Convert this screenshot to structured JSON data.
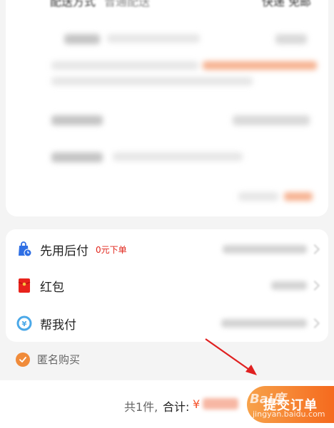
{
  "order_card": {
    "delivery_label": "配送方式",
    "delivery_value": "普通配送",
    "delivery_right": "快递 免邮"
  },
  "payment": {
    "pay_later": {
      "label": "先用后付",
      "tag": "0元下单"
    },
    "red_packet": {
      "label": "红包"
    },
    "help_pay": {
      "label": "帮我付"
    }
  },
  "anonymous": {
    "label": "匿名购买"
  },
  "bottom_bar": {
    "count_text": "共1件,",
    "total_label": "合计:",
    "currency": "¥",
    "submit_label": "提交订单"
  },
  "watermark": {
    "logo_text": "Bai度",
    "url_text": "jingyan.baidu.com"
  },
  "colors": {
    "accent": "#f56a1e",
    "price": "#f5522b",
    "tag_red": "#e1251b",
    "check": "#f08b3a",
    "arrow": "#e02020"
  },
  "icons": {
    "pay_later": "shopping-bag-clock-icon",
    "red_packet": "red-envelope-icon",
    "help_pay": "yen-coin-icon",
    "anonymous": "checkmark-icon",
    "annotation": "red-arrow"
  }
}
